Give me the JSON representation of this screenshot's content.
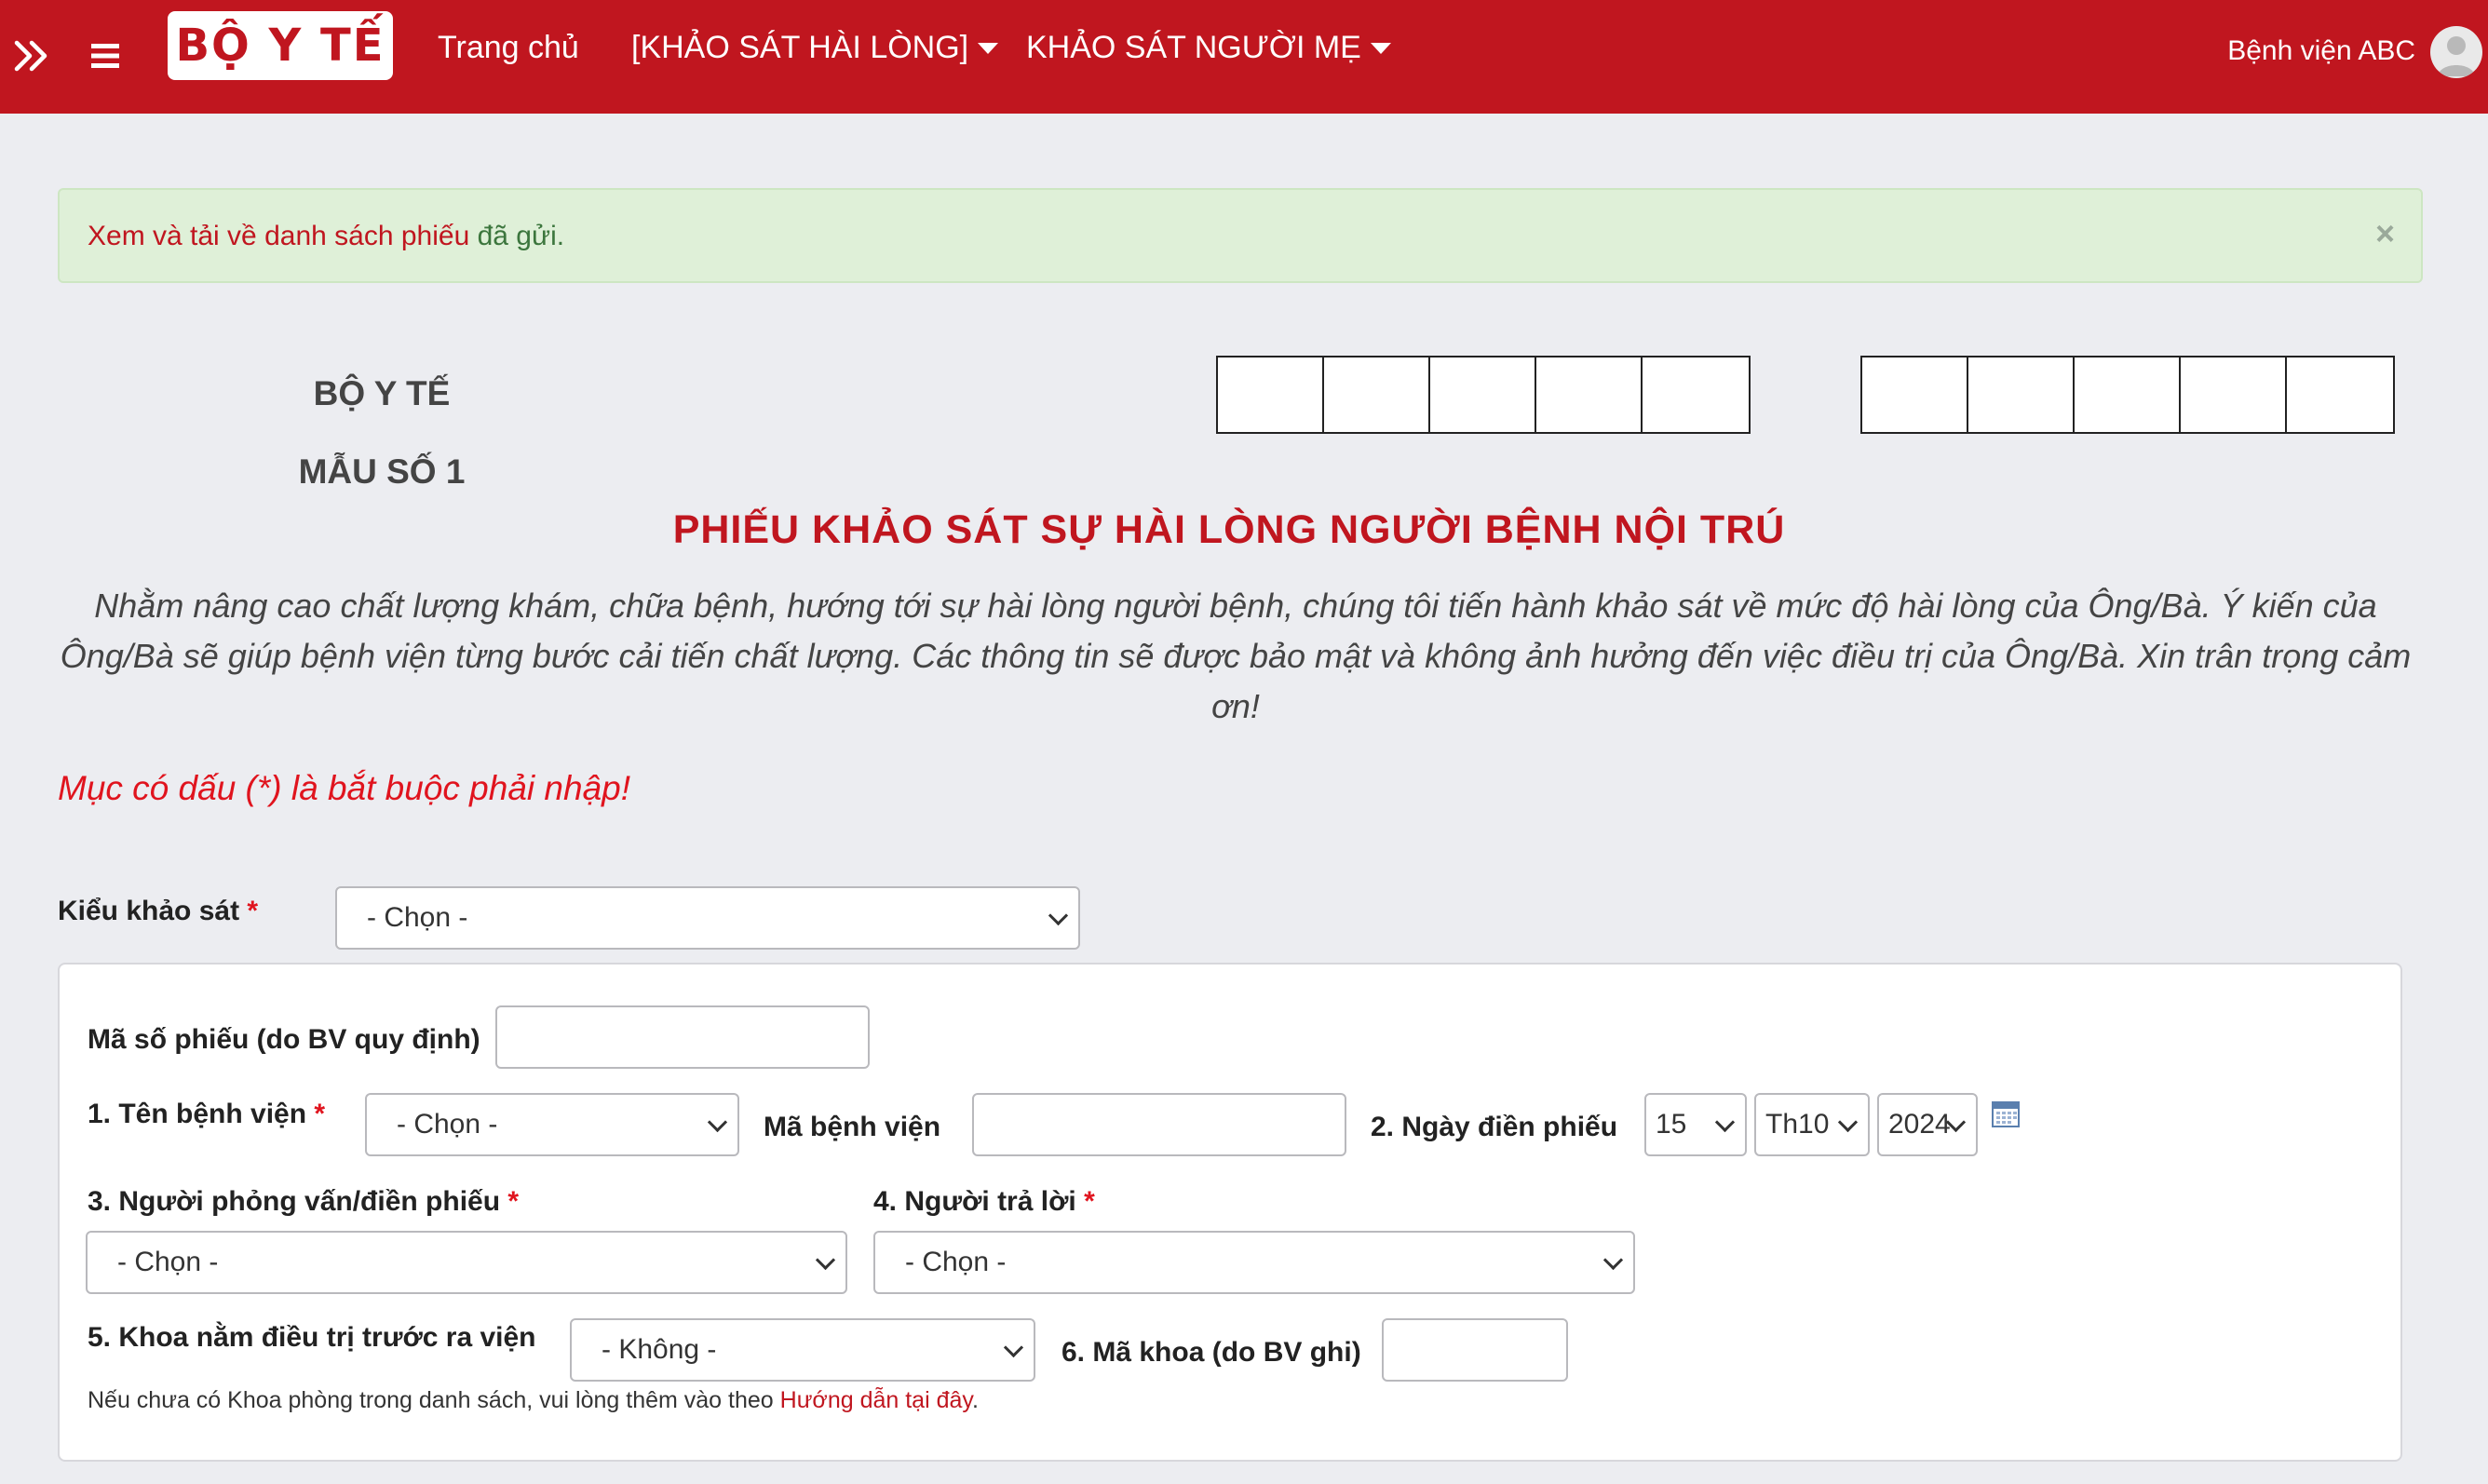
{
  "navbar": {
    "logo_text": "BỘ Y TẾ",
    "menu": [
      {
        "label": "Trang chủ"
      },
      {
        "label": "[KHẢO SÁT HÀI LÒNG]"
      },
      {
        "label": "KHẢO SÁT NGƯỜI MẸ"
      }
    ],
    "user_name": "Bệnh viện ABC",
    "brand_color": "#c0161f"
  },
  "alert": {
    "link_text": "Xem và tải về danh sách phiếu",
    "rest_text": " đã gửi.",
    "close_symbol": "×"
  },
  "form_header": {
    "org_line1": "BỘ Y TẾ",
    "org_line2": "MẪU SỐ 1",
    "title": "PHIẾU KHẢO SÁT SỰ HÀI LÒNG NGƯỜI BỆNH NỘI TRÚ",
    "intro": "Nhằm nâng cao chất lượng khám, chữa bệnh, hướng tới sự hài lòng người bệnh, chúng tôi tiến hành khảo sát về mức độ hài lòng của Ông/Bà. Ý kiến của Ông/Bà sẽ giúp bệnh viện từng bước cải tiến chất lượng. Các thông tin sẽ được bảo mật và không ảnh hưởng đến việc điều trị của Ông/Bà. Xin trân trọng cảm ơn!",
    "required_note": "Mục có dấu (*) là bắt buộc phải nhập!"
  },
  "form": {
    "survey_type": {
      "label": "Kiểu khảo sát",
      "required": "*",
      "value": "- Chọn -"
    },
    "form_code": {
      "label": "Mã số phiếu (do BV quy định)",
      "value": ""
    },
    "hospital_name": {
      "label": "1. Tên bệnh viện",
      "required": "*",
      "value": "- Chọn -"
    },
    "hospital_code": {
      "label": "Mã bệnh viện",
      "value": ""
    },
    "fill_date": {
      "label": "2. Ngày điền phiếu",
      "day": "15",
      "month": "Th10",
      "year": "2024"
    },
    "interviewer": {
      "label": "3. Người phỏng vấn/điền phiếu",
      "required": "*",
      "value": "- Chọn -"
    },
    "respondent": {
      "label": "4. Người trả lời",
      "required": "*",
      "value": "- Chọn -"
    },
    "department": {
      "label": "5. Khoa nằm điều trị trước ra viện",
      "value": "- Không -"
    },
    "department_code": {
      "label": "6. Mã khoa (do BV ghi)",
      "value": ""
    },
    "hint_text": "Nếu chưa có Khoa phòng trong danh sách, vui lòng thêm vào theo ",
    "hint_link": "Hướng dẫn tại đây",
    "hint_end": "."
  }
}
